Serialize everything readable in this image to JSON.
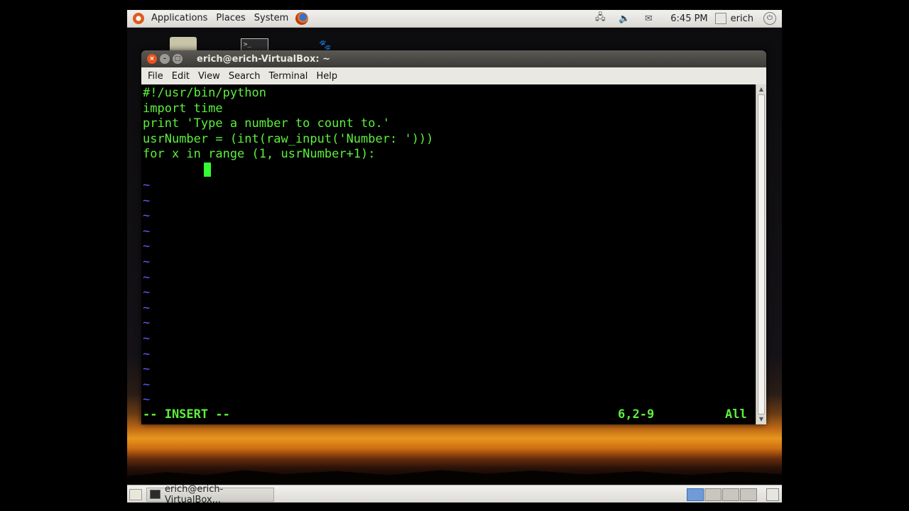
{
  "top_panel": {
    "menus": [
      "Applications",
      "Places",
      "System"
    ],
    "clock": "6:45 PM",
    "user": "erich"
  },
  "window": {
    "title": "erich@erich-VirtualBox: ~",
    "menus": [
      "File",
      "Edit",
      "View",
      "Search",
      "Terminal",
      "Help"
    ]
  },
  "editor": {
    "lines": [
      "#!/usr/bin/python",
      "import time",
      "print 'Type a number to count to.'",
      "usrNumber = (int(raw_input('Number: ')))",
      "for x in range (1, usrNumber+1):"
    ],
    "tilde_count": 15,
    "mode": "-- INSERT --",
    "position": "6,2-9",
    "scroll": "All"
  },
  "bottom_panel": {
    "task": "erich@erich-VirtualBox..."
  },
  "colors": {
    "terminal_text": "#5cf03c",
    "tilde": "#5c5cff",
    "cursor": "#33ff33"
  },
  "icons": [
    "ubuntu-logo-icon",
    "firefox-icon",
    "network-icon",
    "volume-icon",
    "mail-icon",
    "user-icon",
    "power-icon",
    "trash-icon",
    "show-desktop-icon"
  ]
}
